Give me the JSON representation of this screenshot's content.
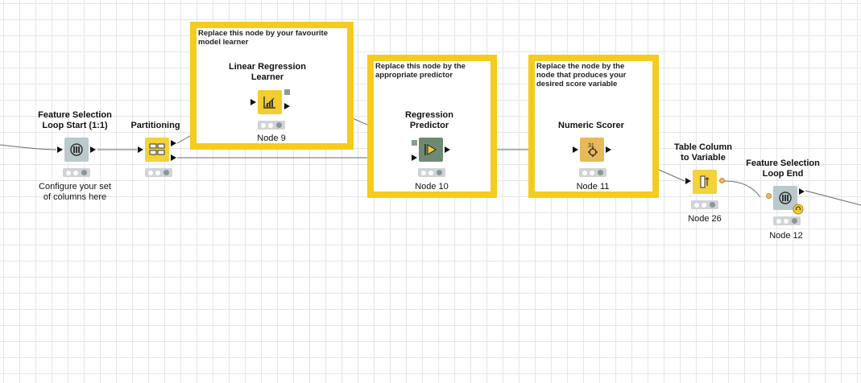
{
  "annotations": [
    {
      "text": "Replace this node by your favourite\nmodel learner"
    },
    {
      "text": "Replace this node by the\nappropriate predictor"
    },
    {
      "text": "Replace the node by the\nnode that produces your\ndesired score variable"
    }
  ],
  "nodes": {
    "loop_start": {
      "title": "Feature Selection\nLoop Start (1:1)",
      "comment": "Configure your set\nof columns here",
      "icon": "loop-start-icon"
    },
    "partitioning": {
      "title": "Partitioning",
      "icon": "table-partition-icon"
    },
    "learner": {
      "title": "Linear Regression\nLearner",
      "label": "Node 9",
      "icon": "regression-learner-icon"
    },
    "predictor": {
      "title": "Regression\nPredictor",
      "label": "Node 10",
      "icon": "predictor-icon"
    },
    "scorer": {
      "title": "Numeric Scorer",
      "label": "Node 11",
      "icon": "scorer-icon",
      "icon_text": "31"
    },
    "col_to_var": {
      "title": "Table Column\nto Variable",
      "label": "Node 26",
      "icon": "column-to-variable-icon"
    },
    "loop_end": {
      "title": "Feature Selection\nLoop End",
      "label": "Node 12",
      "icon": "loop-end-icon"
    }
  },
  "colors": {
    "annotation_border": "#f5cc1e",
    "learner_node": "#f5cc2e",
    "manipulator_node": "#f3d23a",
    "predictor_node": "#6f8a72",
    "scorer_node": "#e8b95a",
    "loop_node": "#b9c9cc",
    "status_bar": "#d0d4d6"
  }
}
